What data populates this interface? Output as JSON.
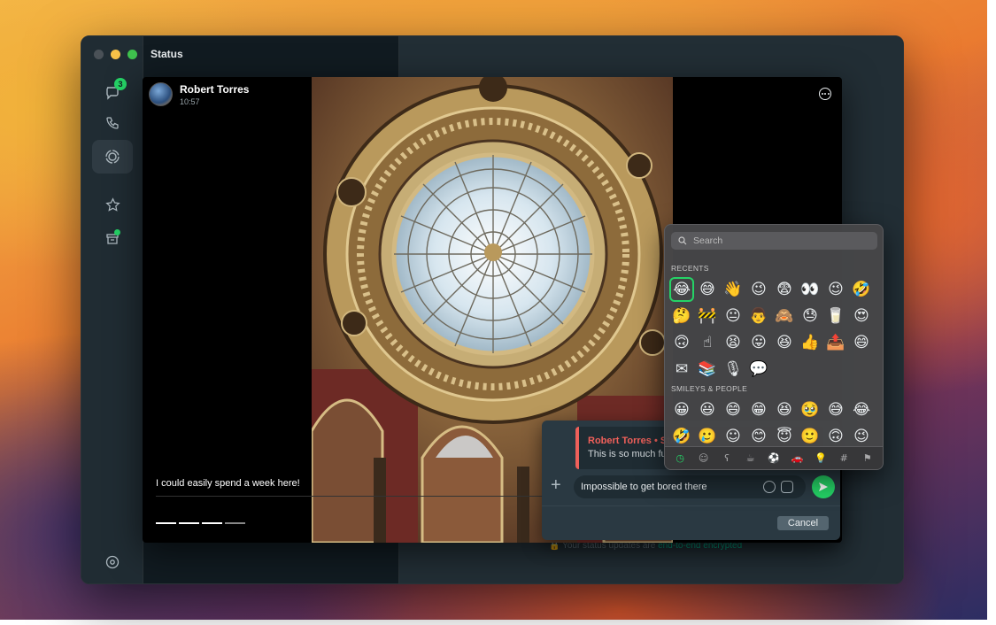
{
  "window": {
    "section_title": "Status",
    "encrypted_prefix": "Your status updates are ",
    "encrypted_link": "end-to-end encrypted"
  },
  "rail": {
    "chats_badge": "3",
    "items": [
      "chats-icon",
      "calls-icon",
      "status-icon",
      "starred-icon",
      "archived-icon",
      "settings-icon"
    ]
  },
  "status_viewer": {
    "contact_name": "Robert Torres",
    "time": "10:57",
    "caption": "I could easily spend a week here!",
    "progress": {
      "segments": 4,
      "completed": 3
    }
  },
  "reply": {
    "quote_name": "Robert Torres • Status",
    "quote_text": "This is so much fun!",
    "input_value": "Impossible to get bored there",
    "cancel_label": "Cancel"
  },
  "emoji_picker": {
    "search_placeholder": "Search",
    "recents_label": "RECENTS",
    "smileys_label": "SMILEYS & PEOPLE",
    "recents": [
      "😂",
      "😅",
      "👋",
      "😉",
      "😨",
      "👀",
      "😉",
      "🤣",
      "🤔",
      "🚧",
      "😐",
      "👨",
      "🙈",
      "😓",
      "🥛",
      "😍",
      "🙃",
      "☝",
      "😫",
      "😛",
      "😆",
      "👍",
      "📤",
      "😄",
      "✉",
      "📚",
      "🎙",
      "💬"
    ],
    "smileys": [
      "😀",
      "😃",
      "😄",
      "😁",
      "😆",
      "🥹",
      "😅",
      "😂",
      "🤣",
      "🥲",
      "☺",
      "😊",
      "😇",
      "🙂",
      "🙃",
      "😉"
    ],
    "tabs": [
      "clock",
      "smiley",
      "bear",
      "cup",
      "ball",
      "car",
      "bulb",
      "symbols",
      "flag"
    ],
    "tab_glyphs": [
      "◷",
      "☺",
      "ʕ",
      "☕",
      "⚽",
      "🚗",
      "💡",
      "#",
      "⚑"
    ]
  }
}
